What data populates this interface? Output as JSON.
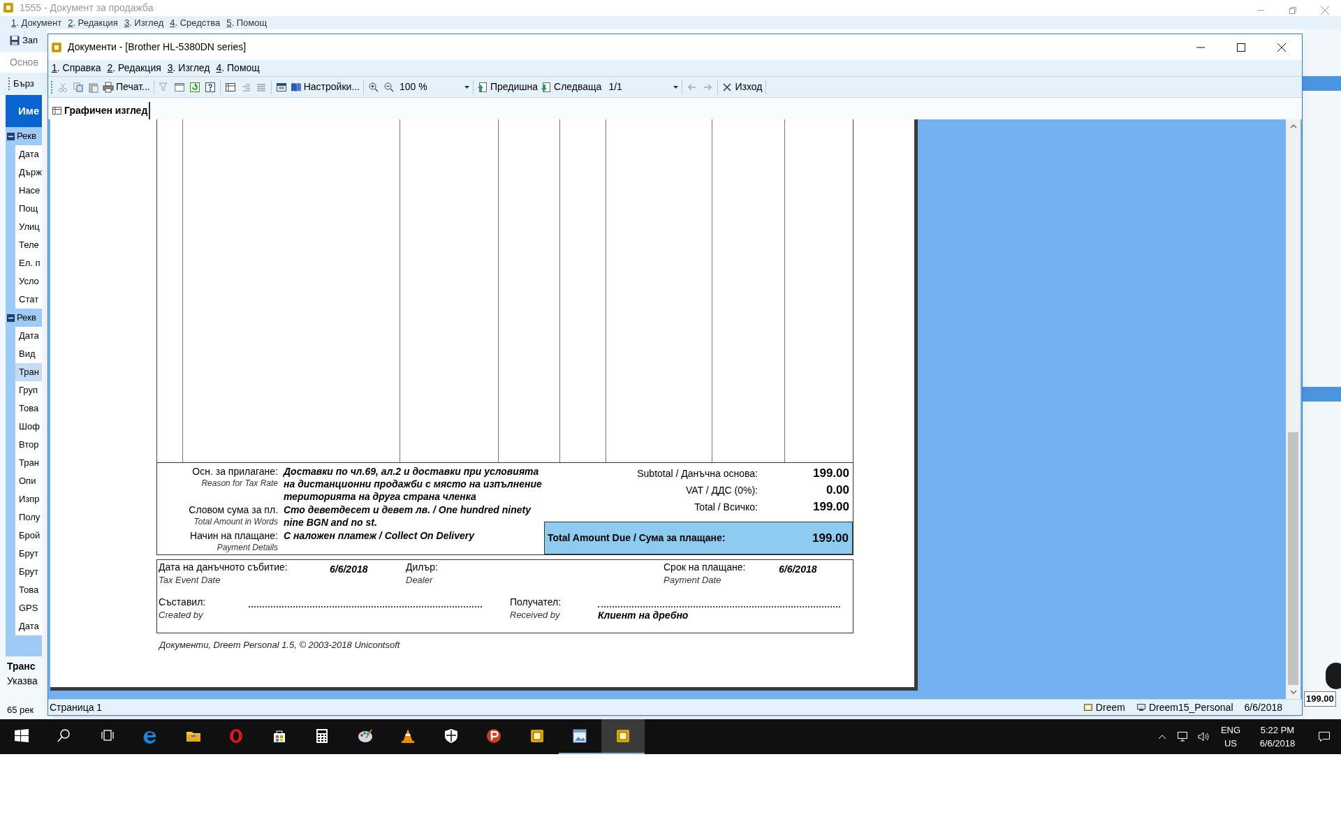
{
  "main_window": {
    "title": "1555 - Документ за продажба",
    "menu": [
      "1. Документ",
      "2. Редакция",
      "3. Изглед",
      "4. Средства",
      "5. Помощ"
    ],
    "save_button": "Зап",
    "section_tab": "Основ",
    "quick_bar": "Бърз",
    "grid_header": "Име",
    "tree": [
      {
        "label": "Рекв",
        "expanded": true,
        "children": [
          {
            "label": "Дата",
            "selected": false
          },
          {
            "label": "Държ",
            "selected": false
          },
          {
            "label": "Насе",
            "selected": false
          },
          {
            "label": "Пощ",
            "selected": false
          },
          {
            "label": "Улиц",
            "selected": false
          },
          {
            "label": "Теле",
            "selected": false
          },
          {
            "label": "Ел. п",
            "selected": false
          },
          {
            "label": "Усло",
            "selected": false
          },
          {
            "label": "Стат",
            "selected": false
          }
        ]
      },
      {
        "label": "Рекв",
        "expanded": true,
        "children": [
          {
            "label": "Дата",
            "selected": false
          },
          {
            "label": "Вид",
            "selected": false
          },
          {
            "label": "Тран",
            "selected": true
          },
          {
            "label": "Груп",
            "selected": false
          },
          {
            "label": "Това",
            "selected": false
          },
          {
            "label": "Шоф",
            "selected": false
          },
          {
            "label": "Втор",
            "selected": false
          },
          {
            "label": "Тран",
            "selected": false
          },
          {
            "label": "Опи",
            "selected": false
          },
          {
            "label": "Изпр",
            "selected": false
          },
          {
            "label": "Полу",
            "selected": false
          },
          {
            "label": "Брой",
            "selected": false
          },
          {
            "label": "Брут",
            "selected": false
          },
          {
            "label": "Брут",
            "selected": false
          },
          {
            "label": "Това",
            "selected": false
          },
          {
            "label": "GPS",
            "selected": false
          },
          {
            "label": "Дата",
            "selected": false
          }
        ]
      }
    ],
    "details_title": "Транс",
    "details_text": "Указва",
    "record_count": "65 рек",
    "total_value": "199.00"
  },
  "document_window": {
    "title": "Документи - [Brother HL-5380DN series]",
    "menu": [
      "1. Справка",
      "2. Редакция",
      "3. Изглед",
      "4. Помощ"
    ],
    "toolbar": {
      "print": "Печат...",
      "settings": "Настройки...",
      "zoom": "100 %",
      "previous": "Предишна",
      "next": "Следваща",
      "page": "1/1",
      "exit": "Изход"
    },
    "tabs": [
      {
        "label": "Графичен изглед",
        "selected": true
      }
    ],
    "document": {
      "reason_label": "Осн. за прилагане:",
      "reason_label_en": "Reason for Tax Rate",
      "reason": "Доставки по чл.69, ал.2 и доставки при условията\nна дистанционни продажби с място на изпълнение\nтериторията на друга страна членка",
      "words_label": "Словом сума за пл.",
      "words_label_en": "Total Amount in Words",
      "words": "Сто деветдесет и девет лв. / One hundred ninety\nnine BGN and no st.",
      "payment_label": "Начин на плащане:",
      "payment_label_en": "Payment Details",
      "payment": "С наложен платеж / Collect On Delivery",
      "totals": [
        {
          "label": "Subtotal / Данъчна основа:",
          "value": "199.00"
        },
        {
          "label": "VAT / ДДС  (0%):",
          "value": "0.00"
        },
        {
          "label": "Total / Всичко:",
          "value": "199.00"
        }
      ],
      "due": {
        "label": "Total Amount Due / Сума за плащане:",
        "value": "199.00"
      },
      "tax_event_label": "Дата на данъчното събитие:",
      "tax_event_label_en": "Tax Event Date",
      "tax_event": "6/6/2018",
      "dealer_label": "Дилър:",
      "dealer_label_en": "Dealer",
      "due_date_label": "Срок на плащане:",
      "due_date_label_en": "Payment Date",
      "due_date": "6/6/2018",
      "created_label": "Съставил:",
      "created_label_en": "Created by",
      "received_label": "Получател:",
      "received_label_en": "Received by",
      "received": "Клиент на дребно",
      "footer": "Документи, Dreem Personal 1.5, © 2003-2018 Unicontsoft"
    },
    "status_bar": {
      "page": "Страница 1",
      "database": "Dreem",
      "profile": "Dreem15_Personal",
      "date": "6/6/2018"
    }
  },
  "taskbar": {
    "apps": [
      {
        "running": false,
        "selected": false
      },
      {
        "running": false,
        "selected": false
      },
      {
        "running": false,
        "selected": false
      },
      {
        "running": false,
        "selected": false
      },
      {
        "running": false,
        "selected": false
      },
      {
        "running": false,
        "selected": false
      },
      {
        "running": false,
        "selected": false
      },
      {
        "running": false,
        "selected": false
      },
      {
        "running": false,
        "selected": false
      },
      {
        "running": false,
        "selected": false
      },
      {
        "running": true,
        "selected": false
      },
      {
        "running": true,
        "selected": true
      }
    ],
    "language": "ENG",
    "region": "US",
    "time": "5:22 PM",
    "date": "6/6/2018"
  }
}
